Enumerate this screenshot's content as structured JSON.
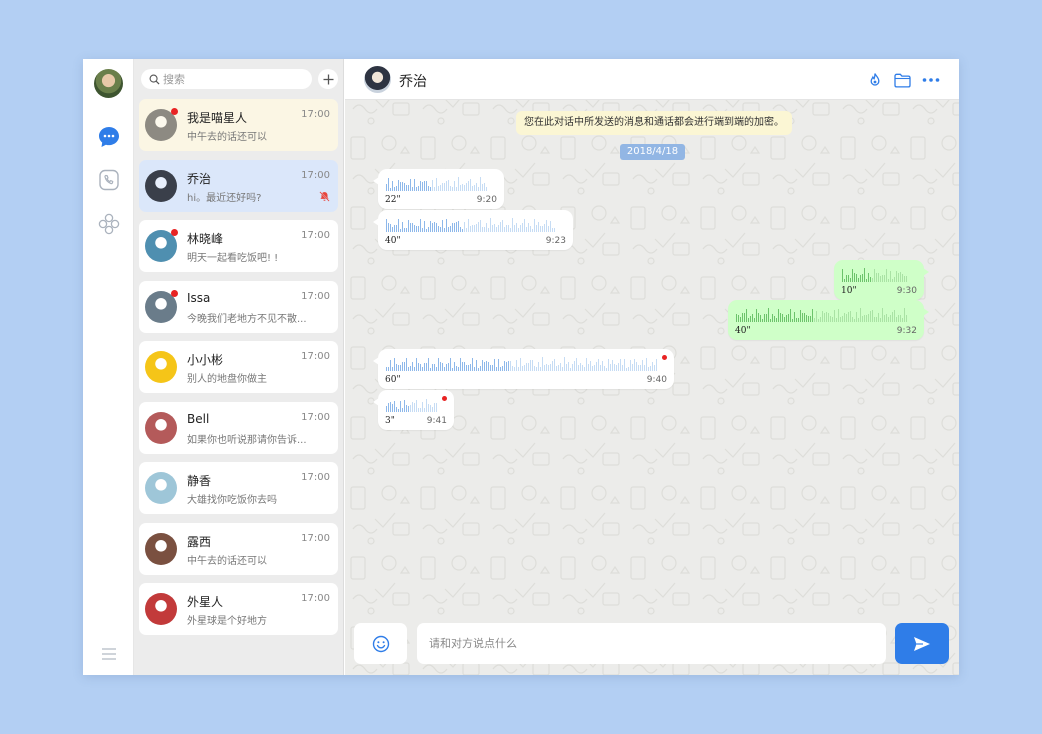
{
  "search": {
    "placeholder": "搜索"
  },
  "chats": [
    {
      "name": "我是喵星人",
      "time": "17:00",
      "preview": "中午去的话还可以",
      "unread": true,
      "pinned": true,
      "selected": false,
      "muted": false,
      "avatar_color": "#8d8a82"
    },
    {
      "name": "乔治",
      "time": "17:00",
      "preview": "hi。最近还好吗?",
      "unread": false,
      "pinned": false,
      "selected": true,
      "muted": true,
      "avatar_color": "#3a3f4a"
    },
    {
      "name": "林晓峰",
      "time": "17:00",
      "preview": "明天一起看吃饭吧! !",
      "unread": true,
      "pinned": false,
      "selected": false,
      "muted": false,
      "avatar_color": "#4f8fb0"
    },
    {
      "name": "Issa",
      "time": "17:00",
      "preview": "今晚我们老地方不见不散...",
      "unread": true,
      "pinned": false,
      "selected": false,
      "muted": false,
      "avatar_color": "#6a7c8a"
    },
    {
      "name": "小小彬",
      "time": "17:00",
      "preview": "别人的地盘你做主",
      "unread": false,
      "pinned": false,
      "selected": false,
      "muted": false,
      "avatar_color": "#f5c518"
    },
    {
      "name": "Bell",
      "time": "17:00",
      "preview": "如果你也听说那请你告诉...",
      "unread": false,
      "pinned": false,
      "selected": false,
      "muted": false,
      "avatar_color": "#b45a5a"
    },
    {
      "name": "静香",
      "time": "17:00",
      "preview": "大雄找你吃饭你去吗",
      "unread": false,
      "pinned": false,
      "selected": false,
      "muted": false,
      "avatar_color": "#9ec6d8"
    },
    {
      "name": "露西",
      "time": "17:00",
      "preview": "中午去的话还可以",
      "unread": false,
      "pinned": false,
      "selected": false,
      "muted": false,
      "avatar_color": "#7a5040"
    },
    {
      "name": "外星人",
      "time": "17:00",
      "preview": "外星球是个好地方",
      "unread": false,
      "pinned": false,
      "selected": false,
      "muted": false,
      "avatar_color": "#c23a3a"
    }
  ],
  "header": {
    "title": "乔治"
  },
  "conversation": {
    "notice": "您在此对话中所发送的消息和通话都会进行端到端的加密。",
    "date": "2018/4/18",
    "messages": [
      {
        "direction": "in",
        "duration": "22\"",
        "time": "9:20",
        "unread": false
      },
      {
        "direction": "in",
        "duration": "40\"",
        "time": "9:23",
        "unread": false
      },
      {
        "direction": "out",
        "duration": "10\"",
        "time": "9:30",
        "unread": false
      },
      {
        "direction": "out",
        "duration": "40\"",
        "time": "9:32",
        "unread": false
      },
      {
        "direction": "in",
        "duration": "60\"",
        "time": "9:40",
        "unread": true
      },
      {
        "direction": "in",
        "duration": "3\"",
        "time": "9:41",
        "unread": true
      }
    ]
  },
  "composer": {
    "placeholder": "请和对方说点什么"
  },
  "colors": {
    "accent": "#2f7de8",
    "outgoing": "#cfffc8",
    "unread_dot": "#e82323",
    "pinned_bg": "#fbf6e4",
    "selected_bg": "#dbe7fa"
  },
  "icons": {
    "rail": [
      "chat-icon",
      "phone-icon",
      "apps-icon",
      "menu-icon"
    ],
    "header": [
      "fire-icon",
      "folder-icon",
      "more-icon"
    ],
    "composer": [
      "emoji-icon",
      "send-icon"
    ]
  }
}
